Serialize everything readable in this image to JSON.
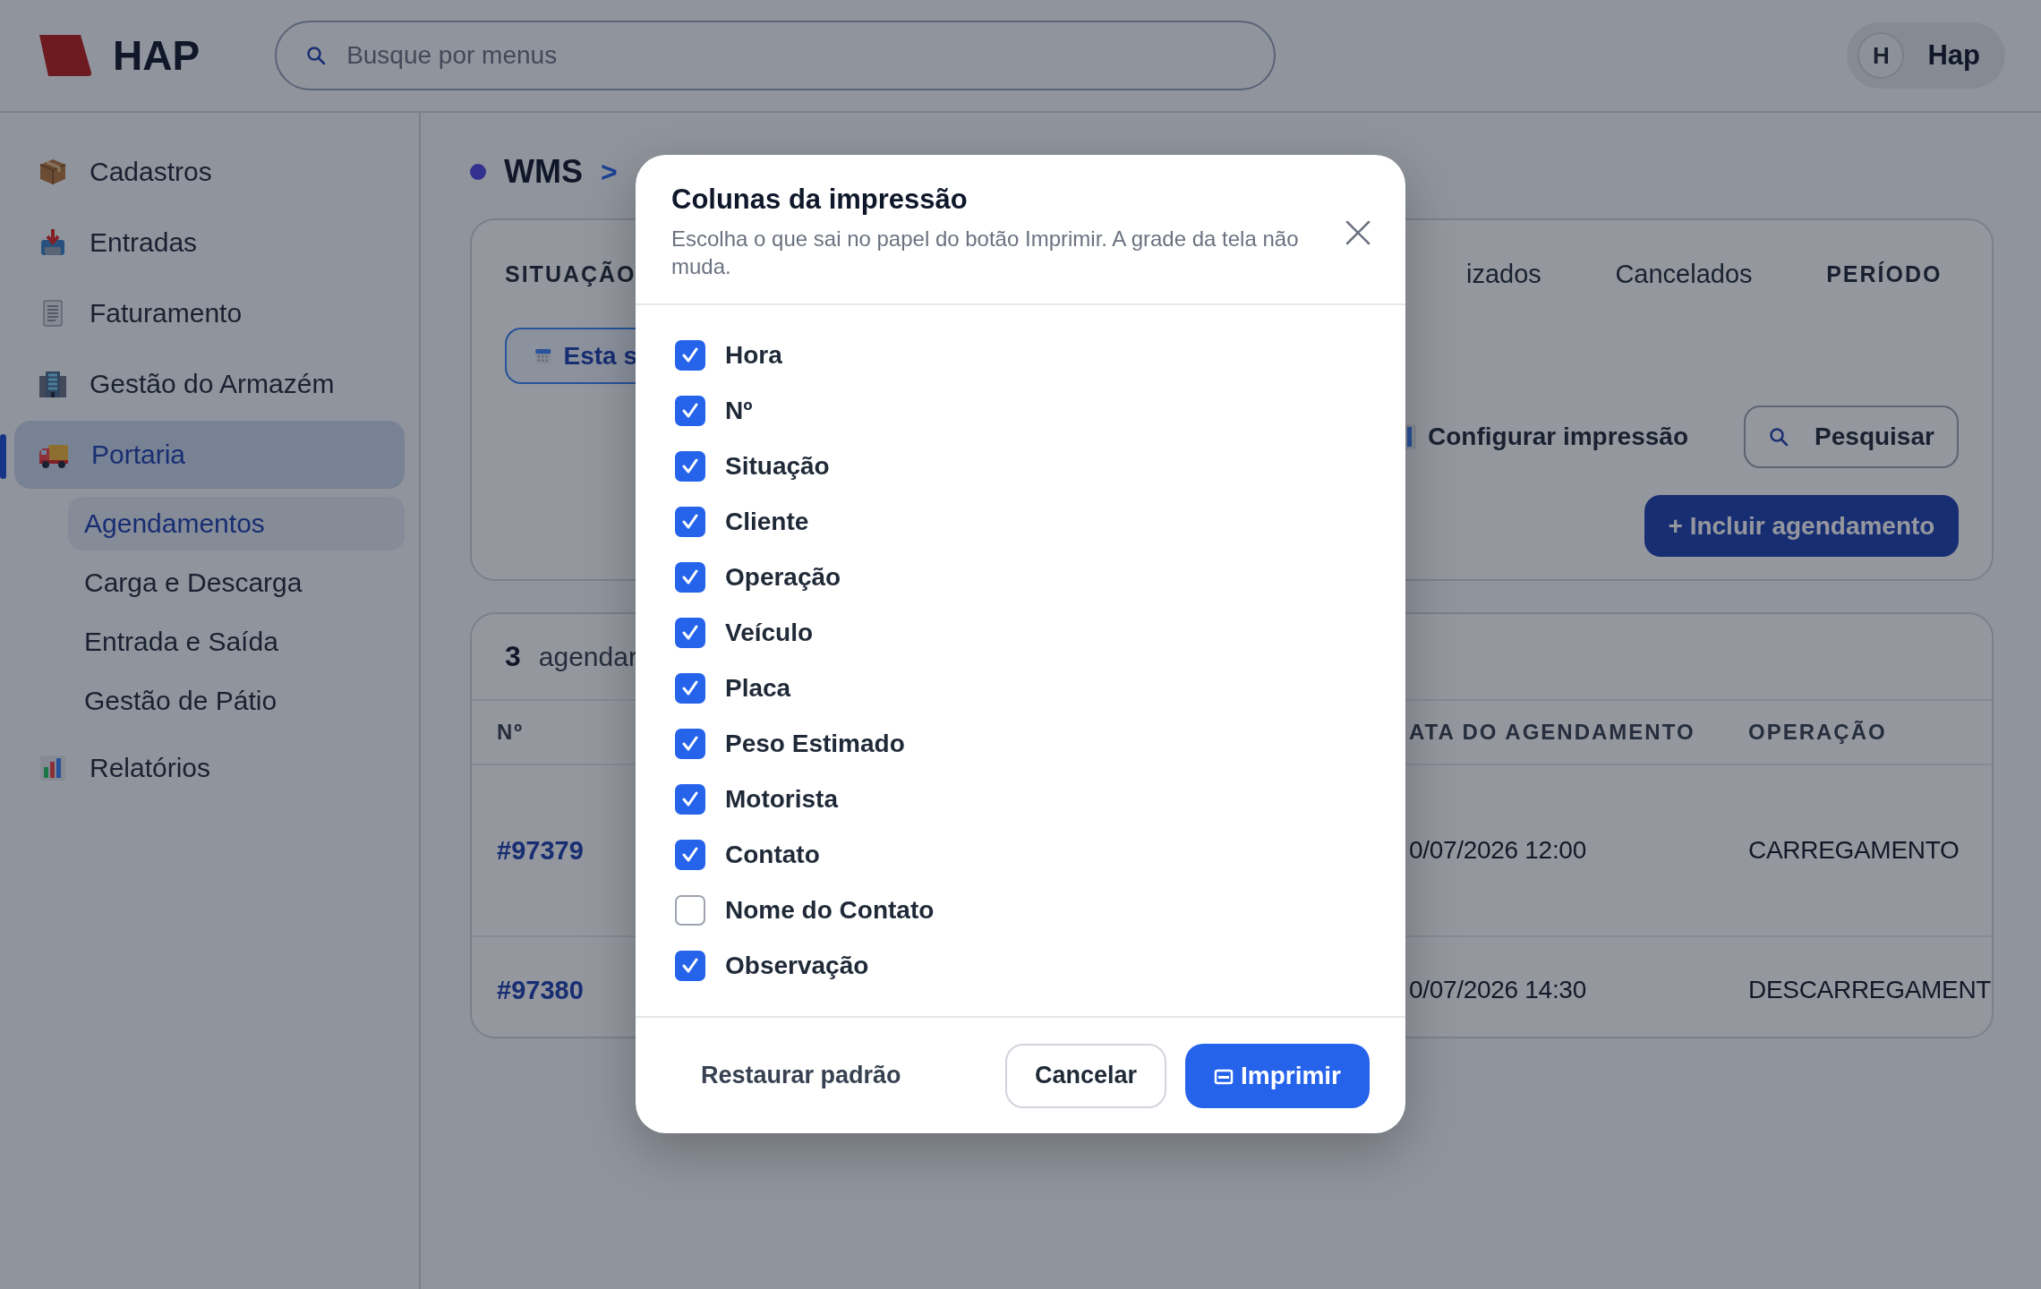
{
  "header": {
    "logo_text": "HAP",
    "search": {
      "placeholder": "Busque por menus"
    },
    "user": {
      "initial": "H",
      "name": "Hap"
    }
  },
  "sidebar": {
    "items": [
      {
        "label": "Cadastros",
        "selected": false
      },
      {
        "label": "Entradas",
        "selected": false
      },
      {
        "label": "Faturamento",
        "selected": false
      },
      {
        "label": "Gestão do Armazém",
        "selected": false
      },
      {
        "label": "Portaria",
        "selected": true,
        "children": [
          {
            "label": "Agendamentos",
            "selected": true
          },
          {
            "label": "Carga e Descarga",
            "selected": false
          },
          {
            "label": "Entrada e Saída",
            "selected": false
          },
          {
            "label": "Gestão de Pátio",
            "selected": false
          }
        ]
      },
      {
        "label": "Relatórios",
        "selected": false
      }
    ]
  },
  "breadcrumb": {
    "items": [
      "WMS"
    ],
    "separator": ">"
  },
  "filters": {
    "situation_label": "SITUAÇÃO",
    "status_tabs": [
      "izados",
      "Cancelados"
    ],
    "period_label": "PERÍODO",
    "period_button": "Esta s",
    "configure_print": "Configurar impressão",
    "search_button": "Pesquisar",
    "add_button": "+ Incluir agendamento"
  },
  "results": {
    "count": "3",
    "count_label": "agendar",
    "columns": [
      "Nº",
      "ATA DO AGENDAMENTO",
      "OPERAÇÃO"
    ],
    "rows": [
      {
        "number": "#97379",
        "date": "0/07/2026 12:00",
        "operation": "CARREGAMENTO"
      },
      {
        "number": "#97380",
        "date": "0/07/2026 14:30",
        "operation": "DESCARREGAMENT"
      }
    ]
  },
  "dialog": {
    "title": "Colunas da impressão",
    "description": "Escolha o que sai no papel do botão Imprimir. A grade da tela não muda.",
    "columns": [
      {
        "label": "Hora",
        "checked": true
      },
      {
        "label": "Nº",
        "checked": true
      },
      {
        "label": "Situação",
        "checked": true
      },
      {
        "label": "Cliente",
        "checked": true
      },
      {
        "label": "Operação",
        "checked": true
      },
      {
        "label": "Veículo",
        "checked": true
      },
      {
        "label": "Placa",
        "checked": true
      },
      {
        "label": "Peso Estimado",
        "checked": true
      },
      {
        "label": "Motorista",
        "checked": true
      },
      {
        "label": "Contato",
        "checked": true
      },
      {
        "label": "Nome do Contato",
        "checked": false
      },
      {
        "label": "Observação",
        "checked": true
      }
    ],
    "restore_button": "Restaurar padrão",
    "cancel_button": "Cancelar",
    "print_button": "Imprimir"
  }
}
